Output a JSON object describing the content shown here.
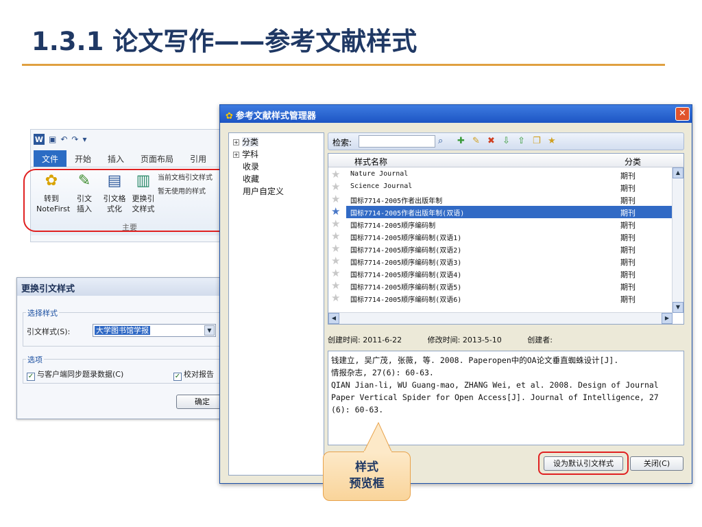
{
  "slide": {
    "title": "1.3.1  论文写作——参考文献样式"
  },
  "ribbon": {
    "tabs": [
      "文件",
      "开始",
      "插入",
      "页面布局",
      "引用"
    ],
    "buttons": [
      {
        "label_top": "转到",
        "label_bottom": "NoteFirst"
      },
      {
        "label_top": "引文",
        "label_bottom": "插入"
      },
      {
        "label_top": "引文格",
        "label_bottom": "式化"
      },
      {
        "label_top": "更换引",
        "label_bottom": "文样式"
      }
    ],
    "options": [
      "当前文档引文样式",
      "暂无使用的样式"
    ],
    "group_label": "主要"
  },
  "change_dialog": {
    "title": "更换引文样式",
    "group_style": "选择样式",
    "style_label": "引文样式(S):",
    "style_value": "大学图书馆学报",
    "group_options": "选项",
    "sync_label": "与客户端同步题录数据(C)",
    "check_label": "校对报告",
    "ok_label": "确定"
  },
  "manager": {
    "title": "参考文献样式管理器",
    "tree": [
      "分类",
      "学科",
      "收录",
      "收藏",
      "用户自定义"
    ],
    "search_label": "检索:",
    "columns": {
      "name": "样式名称",
      "category": "分类"
    },
    "rows": [
      {
        "name": "Nature Journal",
        "category": "期刊"
      },
      {
        "name": "Science Journal",
        "category": "期刊"
      },
      {
        "name": "国标7714-2005作者出版年制",
        "category": "期刊"
      },
      {
        "name": "国标7714-2005作者出版年制(双语)",
        "category": "期刊"
      },
      {
        "name": "国标7714-2005顺序编码制",
        "category": "期刊"
      },
      {
        "name": "国标7714-2005顺序编码制(双语1)",
        "category": "期刊"
      },
      {
        "name": "国标7714-2005顺序编码制(双语2)",
        "category": "期刊"
      },
      {
        "name": "国标7714-2005顺序编码制(双语3)",
        "category": "期刊"
      },
      {
        "name": "国标7714-2005顺序编码制(双语4)",
        "category": "期刊"
      },
      {
        "name": "国标7714-2005顺序编码制(双语5)",
        "category": "期刊"
      },
      {
        "name": "国标7714-2005顺序编码制(双语6)",
        "category": "期刊"
      }
    ],
    "created": "创建时间: 2011-6-22",
    "modified": "修改时间: 2013-5-10",
    "creator": "创建者:",
    "preview_lines": [
      "钱建立, 吴广茂, 张薇, 等. 2008. Paperopen中的OA论文垂直蜘蛛设计[J].",
      "情报杂志, 27(6): 60-63.",
      "QIAN Jian-li, WU Guang-mao, ZHANG Wei, et al. 2008. Design of Journal",
      "Paper Vertical Spider for Open Access[J]. Journal of Intelligence, 27",
      "(6): 60-63."
    ],
    "set_default_label": "设为默认引文样式",
    "close_label": "关闭(C)"
  },
  "callout": {
    "line1": "样式",
    "line2": "预览框"
  },
  "colors": {
    "title": "#1f3864",
    "rule": "#e0a040",
    "highlight": "#316ac5",
    "annotation": "#e02020"
  }
}
